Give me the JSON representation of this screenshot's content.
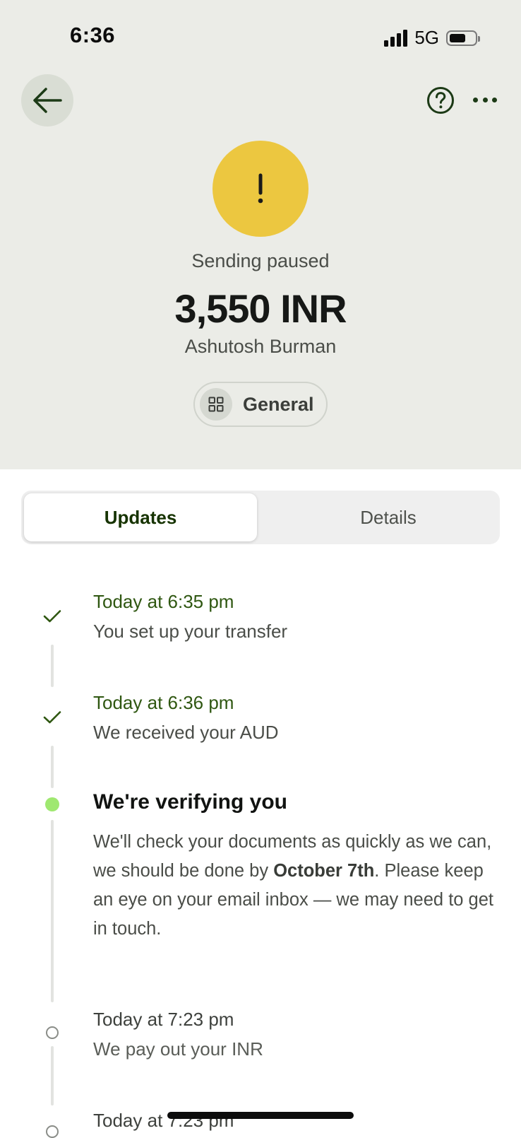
{
  "status_bar": {
    "time": "6:36",
    "network": "5G"
  },
  "header": {
    "back_icon": "arrow-left-icon",
    "help_icon": "question-circle-icon",
    "more_icon": "more-horizontal-icon"
  },
  "transfer": {
    "status_icon": "exclamation-icon",
    "status_color": "#ecc740",
    "status_label": "Sending paused",
    "amount": "3,550 INR",
    "recipient": "Ashutosh Burman",
    "category_icon": "grid-icon",
    "category": "General"
  },
  "tabs": [
    {
      "label": "Updates",
      "active": true
    },
    {
      "label": "Details",
      "active": false
    }
  ],
  "timeline": {
    "step1": {
      "time": "Today at 6:35 pm",
      "text": "You set up your transfer",
      "state": "done"
    },
    "step2": {
      "time": "Today at 6:36 pm",
      "text": "We received your AUD",
      "state": "done"
    },
    "step3": {
      "title": "We're verifying you",
      "body_before": "We'll check your documents as quickly as we can, we should be done by ",
      "body_bold": "October 7th",
      "body_after": ". Please keep an eye on your email inbox — we may need to get in touch.",
      "state": "active"
    },
    "step4": {
      "time": "Today at 7:23 pm",
      "text": "We pay out your INR",
      "state": "pending"
    },
    "step5": {
      "time": "Today at 7:23 pm",
      "state": "pending"
    }
  },
  "colors": {
    "accent_green": "#9fe870",
    "brand_dark": "#163300",
    "done_green": "#2f5711",
    "header_bg": "#ebece7"
  }
}
